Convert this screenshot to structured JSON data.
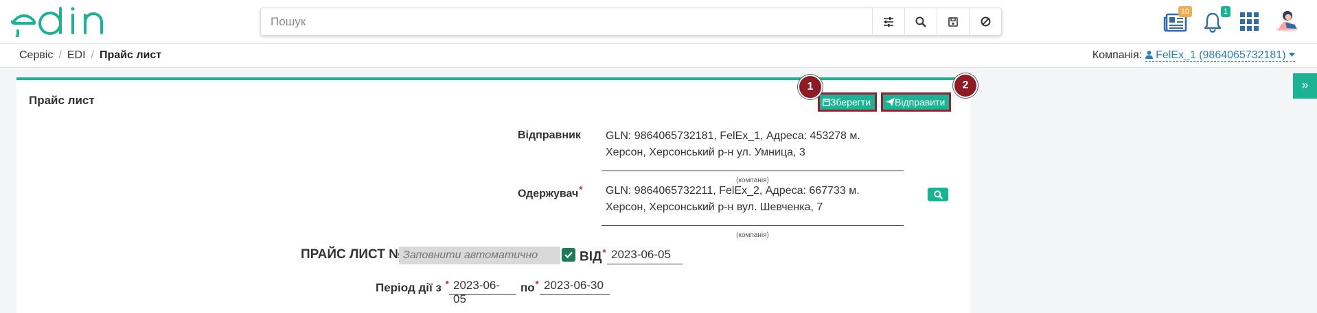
{
  "header": {
    "logo_text": "edin",
    "search_placeholder": "Пошук",
    "icons": {
      "filter": "sliders-icon",
      "search": "search-icon",
      "save": "floppy-icon",
      "clear": "ban-icon"
    },
    "news_badge": "10",
    "notifications_badge": "1"
  },
  "breadcrumb": {
    "items": [
      "Сервіс",
      "EDI"
    ],
    "current": "Прайс лист"
  },
  "company": {
    "label": "Компанія:",
    "value": "FelEx_1 (9864065732181)"
  },
  "side_tab": {
    "label": "»"
  },
  "card": {
    "title": "Прайс лист",
    "save_button": "Зберегти",
    "send_button": "Відправити",
    "callout_1": "1",
    "callout_2": "2",
    "sender": {
      "label": "Відправник",
      "line1": "GLN: 9864065732181, FelEx_1, Адреса: 453278 м.",
      "line2": "Херсон, Херсонський р-н ул. Умница, 3",
      "caption": "(компанія)"
    },
    "receiver": {
      "label": "Одержувач",
      "required_mark": "*",
      "line1": "GLN: 9864065732211, FelEx_2, Адреса: 667733 м.",
      "line2": "Херсон, Херсонський р-н вул. Шевченка, 7",
      "caption": "(компанія)"
    },
    "doc": {
      "label": "ПРАЙС ЛИСТ №",
      "autofill_placeholder": "Заповнити автоматично",
      "from_label": "ВІД",
      "required_mark": "*",
      "date": "2023-06-05"
    },
    "period": {
      "label": "Період дії з",
      "required_mark": "*",
      "from": "2023-06-05",
      "to_label": "по",
      "to": "2023-06-30"
    }
  },
  "colors": {
    "accent": "#1ab394",
    "callout": "#8e1a24",
    "link": "#2d7fc0",
    "news_badge": "#f0ad4e",
    "notif_badge": "#1ab394"
  }
}
